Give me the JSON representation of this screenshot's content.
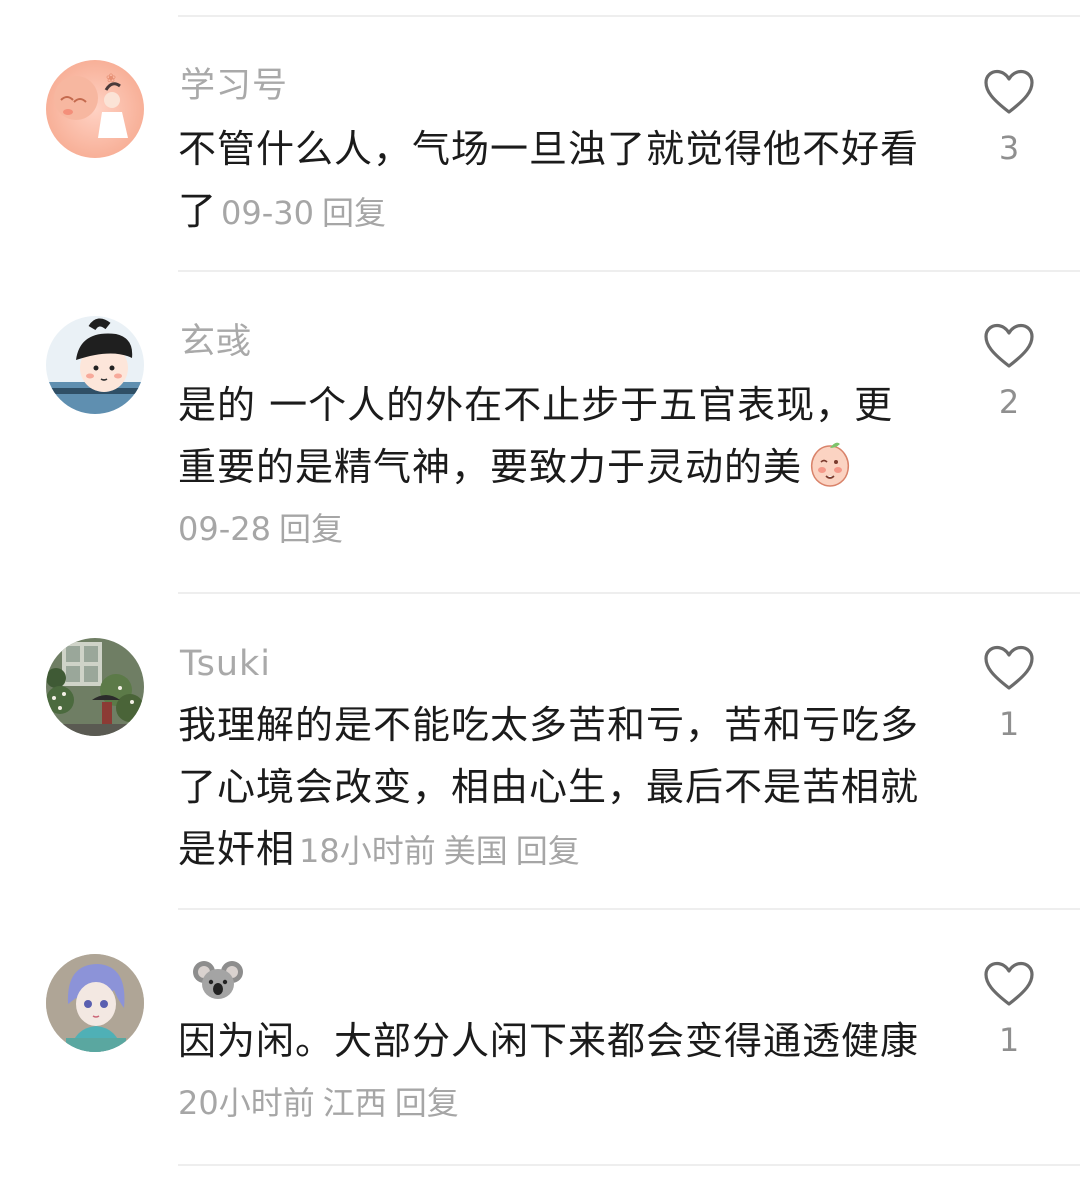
{
  "comments": [
    {
      "username": "学习号",
      "lines": [
        "不管什么人，气场一旦浊了就觉得他不好看",
        "了"
      ],
      "time": "09-30",
      "location": "",
      "reply": "回复",
      "likes": "3",
      "avatar_icon": "girl-pink-avatar-icon"
    },
    {
      "username": "玄彧",
      "lines": [
        "是的 一个人的外在不止步于五官表现，更",
        "重要的是精气神，要致力于灵动的美"
      ],
      "time": "09-28",
      "location": "",
      "reply": "回复",
      "likes": "2",
      "avatar_icon": "cartoon-boy-avatar-icon",
      "emoji_icon": "blushing-peach-emoji-icon"
    },
    {
      "username": "Tsuki",
      "lines": [
        "我理解的是不能吃太多苦和亏，苦和亏吃多",
        "了心境会改变，相由心生，最后不是苦相就",
        "是奸相"
      ],
      "time": "18小时前",
      "location": "美国",
      "reply": "回复",
      "likes": "1",
      "avatar_icon": "garden-photo-avatar-icon"
    },
    {
      "username": "",
      "username_icon": "koala-emoji-icon",
      "lines": [
        "因为闲。大部分人闲下来都会变得通透健康"
      ],
      "time": "20小时前",
      "location": "江西",
      "reply": "回复",
      "likes": "1",
      "avatar_icon": "doll-photo-avatar-icon"
    }
  ],
  "colors": {
    "username": "#a9a9a9",
    "body": "#1b1b1b",
    "meta": "#a6a6a6",
    "icon": "#6b6b6b",
    "divider": "#eeeeee"
  }
}
